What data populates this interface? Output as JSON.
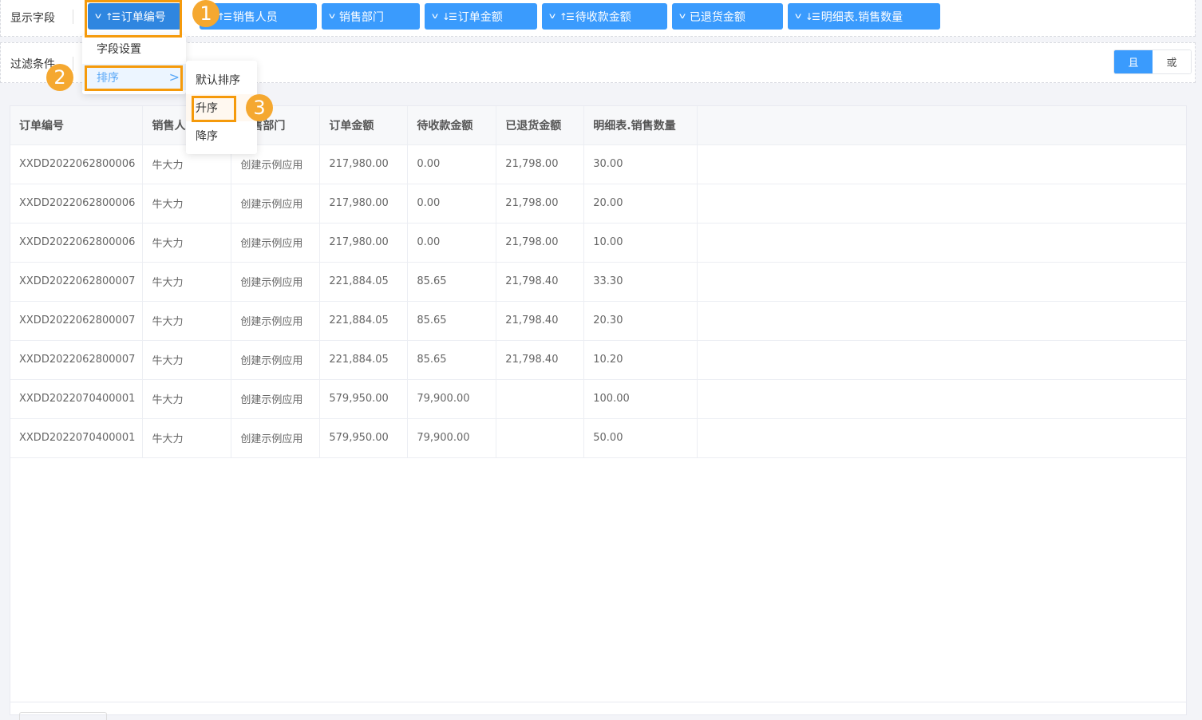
{
  "fields_bar": {
    "label": "显示字段",
    "buttons": [
      {
        "label": "订单编号",
        "sort": "asc"
      },
      {
        "label": "销售人员",
        "sort": "asc"
      },
      {
        "label": "销售部门",
        "sort": ""
      },
      {
        "label": "订单金额",
        "sort": "desc"
      },
      {
        "label": "待收款金额",
        "sort": "asc"
      },
      {
        "label": "已退货金额",
        "sort": ""
      },
      {
        "label": "明细表.销售数量",
        "sort": "desc"
      }
    ]
  },
  "filter_bar": {
    "label": "过滤条件",
    "logic": {
      "and": "且",
      "or": "或",
      "selected": "且"
    }
  },
  "field_menu": {
    "items": [
      "字段设置",
      "排序"
    ]
  },
  "sort_menu": {
    "items": [
      "默认排序",
      "升序",
      "降序"
    ]
  },
  "step_badges": [
    "1",
    "2",
    "3"
  ],
  "table": {
    "columns": [
      "订单编号",
      "销售人员",
      "销售部门",
      "订单金额",
      "待收款金额",
      "已退货金额",
      "明细表.销售数量"
    ],
    "rows": [
      [
        "XXDD2022062800006",
        "牛大力",
        "创建示例应用",
        "217,980.00",
        "0.00",
        "21,798.00",
        "30.00"
      ],
      [
        "XXDD2022062800006",
        "牛大力",
        "创建示例应用",
        "217,980.00",
        "0.00",
        "21,798.00",
        "20.00"
      ],
      [
        "XXDD2022062800006",
        "牛大力",
        "创建示例应用",
        "217,980.00",
        "0.00",
        "21,798.00",
        "10.00"
      ],
      [
        "XXDD2022062800007",
        "牛大力",
        "创建示例应用",
        "221,884.05",
        "85.65",
        "21,798.40",
        "33.30"
      ],
      [
        "XXDD2022062800007",
        "牛大力",
        "创建示例应用",
        "221,884.05",
        "85.65",
        "21,798.40",
        "20.30"
      ],
      [
        "XXDD2022062800007",
        "牛大力",
        "创建示例应用",
        "221,884.05",
        "85.65",
        "21,798.40",
        "10.20"
      ],
      [
        "XXDD2022070400001",
        "牛大力",
        "创建示例应用",
        "579,950.00",
        "79,900.00",
        "",
        "100.00"
      ],
      [
        "XXDD2022070400001",
        "牛大力",
        "创建示例应用",
        "579,950.00",
        "79,900.00",
        "",
        "50.00"
      ]
    ]
  },
  "colors": {
    "primary": "#3a9bfd",
    "highlight": "#f59a0b",
    "badge": "#f5a830"
  }
}
